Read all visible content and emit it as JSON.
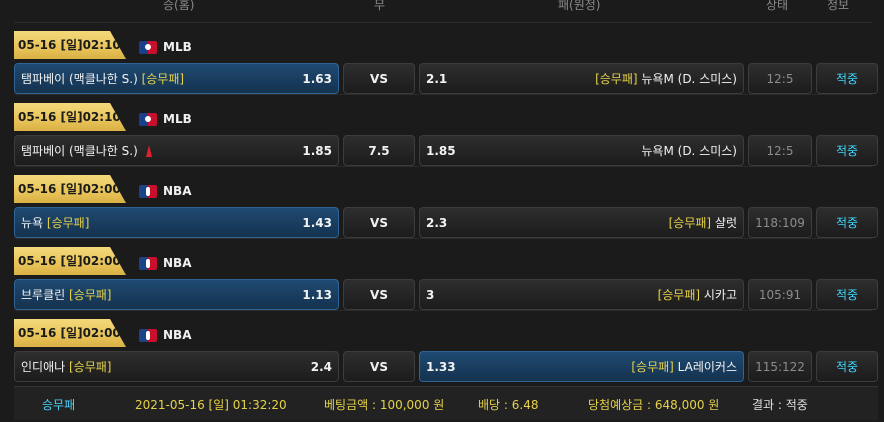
{
  "header": {
    "col_win": "승(홈)",
    "col_draw": "무",
    "col_lose": "패(원정)",
    "col_status": "상태",
    "col_info": "정보"
  },
  "games": [
    {
      "date": "05-16 [일]02:10",
      "league": "MLB",
      "league_icon": "mlb-logo-icon",
      "home_team": "탬파베이 (맥클나한 S.)",
      "home_tag": "[승무패]",
      "home_odds": "1.63",
      "home_selected": true,
      "draw": "VS",
      "away_odds": "2.1",
      "away_tag": "[승무패]",
      "away_team": "뉴욕M (D. 스미스)",
      "away_selected": false,
      "status": "12:5",
      "info": "적중"
    },
    {
      "date": "05-16 [일]02:10",
      "league": "MLB",
      "league_icon": "mlb-logo-icon",
      "home_team": "탬파베이 (맥클나한 S.)",
      "home_tag": "",
      "home_odds": "1.85",
      "home_selected": false,
      "home_arrow": "red-up-arrow-icon",
      "draw": "7.5",
      "away_odds": "1.85",
      "away_tag": "",
      "away_team": "뉴욕M (D. 스미스)",
      "away_selected": false,
      "status": "12:5",
      "info": "적중"
    },
    {
      "date": "05-16 [일]02:00",
      "league": "NBA",
      "league_icon": "nba-logo-icon",
      "home_team": "뉴욕",
      "home_tag": "[승무패]",
      "home_odds": "1.43",
      "home_selected": true,
      "draw": "VS",
      "away_odds": "2.3",
      "away_tag": "[승무패]",
      "away_team": "샬럿",
      "away_selected": false,
      "status": "118:109",
      "info": "적중"
    },
    {
      "date": "05-16 [일]02:00",
      "league": "NBA",
      "league_icon": "nba-logo-icon",
      "home_team": "브루클린",
      "home_tag": "[승무패]",
      "home_odds": "1.13",
      "home_selected": true,
      "draw": "VS",
      "away_odds": "3",
      "away_tag": "[승무패]",
      "away_team": "시카고",
      "away_selected": false,
      "status": "105:91",
      "info": "적중"
    },
    {
      "date": "05-16 [일]02:00",
      "league": "NBA",
      "league_icon": "nba-logo-icon",
      "home_team": "인디애나",
      "home_tag": "[승무패]",
      "home_odds": "2.4",
      "home_selected": false,
      "draw": "VS",
      "away_odds": "1.33",
      "away_tag": "[승무패]",
      "away_team": "LA레이커스",
      "away_selected": true,
      "status": "115:122",
      "info": "적중"
    }
  ],
  "footer": {
    "type": "승무패",
    "datetime": "2021-05-16 [일] 01:32:20",
    "bet_amount": "베팅금액 : 100,000 원",
    "odds": "배당 : 6.48",
    "expected_win": "당첨예상금 : 648,000 원",
    "result": "결과 : 적중"
  },
  "colors": {
    "accent_yellow": "#e6d24a",
    "accent_cyan": "#3fd7ff",
    "selected_blue": "#1e4a72",
    "date_gold": "#f4d97a"
  }
}
